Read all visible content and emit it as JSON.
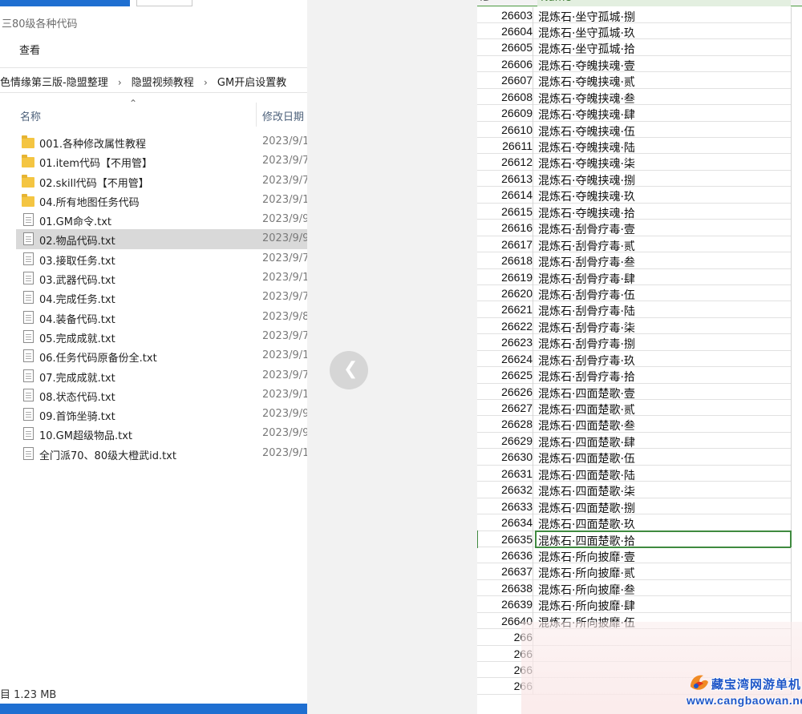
{
  "explorer": {
    "window_title": "三80级各种代码",
    "ribbon_tab": "查看",
    "breadcrumb": [
      "色情缘第三版-隐盟整理",
      "隐盟视频教程",
      "GM开启设置教"
    ],
    "columns": {
      "name": "名称",
      "date": "修改日期"
    },
    "files": [
      {
        "name": "001.各种修改属性教程",
        "date": "2023/9/1",
        "type": "folder"
      },
      {
        "name": "01.item代码【不用管】",
        "date": "2023/9/7",
        "type": "folder"
      },
      {
        "name": "02.skill代码【不用管】",
        "date": "2023/9/7",
        "type": "folder"
      },
      {
        "name": "04.所有地图任务代码",
        "date": "2023/9/1",
        "type": "folder"
      },
      {
        "name": "01.GM命令.txt",
        "date": "2023/9/9",
        "type": "txt"
      },
      {
        "name": "02.物品代码.txt",
        "date": "2023/9/9",
        "type": "txt",
        "selected": true
      },
      {
        "name": "03.接取任务.txt",
        "date": "2023/9/7",
        "type": "txt"
      },
      {
        "name": "03.武器代码.txt",
        "date": "2023/9/1",
        "type": "txt"
      },
      {
        "name": "04.完成任务.txt",
        "date": "2023/9/7",
        "type": "txt"
      },
      {
        "name": "04.装备代码.txt",
        "date": "2023/9/8",
        "type": "txt"
      },
      {
        "name": "05.完成成就.txt",
        "date": "2023/9/7",
        "type": "txt"
      },
      {
        "name": "06.任务代码原备份全.txt",
        "date": "2023/9/1",
        "type": "txt"
      },
      {
        "name": "07.完成成就.txt",
        "date": "2023/9/7",
        "type": "txt"
      },
      {
        "name": "08.状态代码.txt",
        "date": "2023/9/1",
        "type": "txt"
      },
      {
        "name": "09.首饰坐骑.txt",
        "date": "2023/9/9",
        "type": "txt"
      },
      {
        "name": "10.GM超级物品.txt",
        "date": "2023/9/9",
        "type": "txt"
      },
      {
        "name": "全门派70、80级大橙武id.txt",
        "date": "2023/9/1",
        "type": "txt"
      }
    ],
    "status": "目 1.23 MB"
  },
  "viewer": {
    "prev_icon": "chevron-left-icon"
  },
  "sheet": {
    "header": {
      "id": "ID",
      "name": "Name"
    },
    "rows": [
      {
        "id": "26603",
        "name": "混炼石·坐守孤城·捌"
      },
      {
        "id": "26604",
        "name": "混炼石·坐守孤城·玖"
      },
      {
        "id": "26605",
        "name": "混炼石·坐守孤城·拾"
      },
      {
        "id": "26606",
        "name": "混炼石·夺魄挟魂·壹"
      },
      {
        "id": "26607",
        "name": "混炼石·夺魄挟魂·贰"
      },
      {
        "id": "26608",
        "name": "混炼石·夺魄挟魂·叁"
      },
      {
        "id": "26609",
        "name": "混炼石·夺魄挟魂·肆"
      },
      {
        "id": "26610",
        "name": "混炼石·夺魄挟魂·伍"
      },
      {
        "id": "26611",
        "name": "混炼石·夺魄挟魂·陆"
      },
      {
        "id": "26612",
        "name": "混炼石·夺魄挟魂·柒"
      },
      {
        "id": "26613",
        "name": "混炼石·夺魄挟魂·捌"
      },
      {
        "id": "26614",
        "name": "混炼石·夺魄挟魂·玖"
      },
      {
        "id": "26615",
        "name": "混炼石·夺魄挟魂·拾"
      },
      {
        "id": "26616",
        "name": "混炼石·刮骨疗毒·壹"
      },
      {
        "id": "26617",
        "name": "混炼石·刮骨疗毒·贰"
      },
      {
        "id": "26618",
        "name": "混炼石·刮骨疗毒·叁"
      },
      {
        "id": "26619",
        "name": "混炼石·刮骨疗毒·肆"
      },
      {
        "id": "26620",
        "name": "混炼石·刮骨疗毒·伍"
      },
      {
        "id": "26621",
        "name": "混炼石·刮骨疗毒·陆"
      },
      {
        "id": "26622",
        "name": "混炼石·刮骨疗毒·柒"
      },
      {
        "id": "26623",
        "name": "混炼石·刮骨疗毒·捌"
      },
      {
        "id": "26624",
        "name": "混炼石·刮骨疗毒·玖"
      },
      {
        "id": "26625",
        "name": "混炼石·刮骨疗毒·拾"
      },
      {
        "id": "26626",
        "name": "混炼石·四面楚歌·壹"
      },
      {
        "id": "26627",
        "name": "混炼石·四面楚歌·贰"
      },
      {
        "id": "26628",
        "name": "混炼石·四面楚歌·叁"
      },
      {
        "id": "26629",
        "name": "混炼石·四面楚歌·肆"
      },
      {
        "id": "26630",
        "name": "混炼石·四面楚歌·伍"
      },
      {
        "id": "26631",
        "name": "混炼石·四面楚歌·陆"
      },
      {
        "id": "26632",
        "name": "混炼石·四面楚歌·柒"
      },
      {
        "id": "26633",
        "name": "混炼石·四面楚歌·捌"
      },
      {
        "id": "26634",
        "name": "混炼石·四面楚歌·玖"
      },
      {
        "id": "26635",
        "name": "混炼石·四面楚歌·拾",
        "active": true
      },
      {
        "id": "26636",
        "name": "混炼石·所向披靡·壹"
      },
      {
        "id": "26637",
        "name": "混炼石·所向披靡·贰"
      },
      {
        "id": "26638",
        "name": "混炼石·所向披靡·叁"
      },
      {
        "id": "26639",
        "name": "混炼石·所向披靡·肆"
      },
      {
        "id": "26640",
        "name": "混炼石·所向披靡·伍"
      },
      {
        "id": "266",
        "name": ""
      },
      {
        "id": "266",
        "name": ""
      },
      {
        "id": "266",
        "name": ""
      },
      {
        "id": "266",
        "name": ""
      }
    ]
  },
  "watermark": {
    "site_name": "藏宝湾网游单机",
    "url": "www.cangbaowan.net",
    "brand_color": "#1f57c8"
  }
}
